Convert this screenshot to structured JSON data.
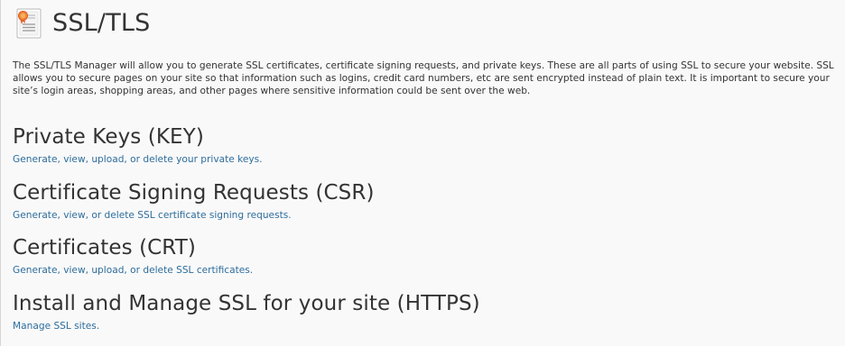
{
  "page": {
    "title": "SSL/TLS",
    "icon": "ssl-certificate-icon",
    "intro": "The SSL/TLS Manager will allow you to generate SSL certificates, certificate signing requests, and private keys. These are all parts of using SSL to secure your website. SSL allows you to secure pages on your site so that information such as logins, credit card numbers, etc are sent encrypted instead of plain text. It is important to secure your site’s login areas, shopping areas, and other pages where sensitive information could be sent over the web."
  },
  "sections": [
    {
      "title": "Private Keys (KEY)",
      "link": "Generate, view, upload, or delete your private keys."
    },
    {
      "title": "Certificate Signing Requests (CSR)",
      "link": "Generate, view, or delete SSL certificate signing requests."
    },
    {
      "title": "Certificates (CRT)",
      "link": "Generate, view, upload, or delete SSL certificates."
    },
    {
      "title": "Install and Manage SSL for your site (HTTPS)",
      "link": "Manage SSL sites."
    }
  ],
  "colors": {
    "background": "#f9f9f9",
    "text": "#333333",
    "link": "#2d6d9c",
    "icon_ribbon": "#e8632b",
    "icon_paper": "#ffffff"
  }
}
